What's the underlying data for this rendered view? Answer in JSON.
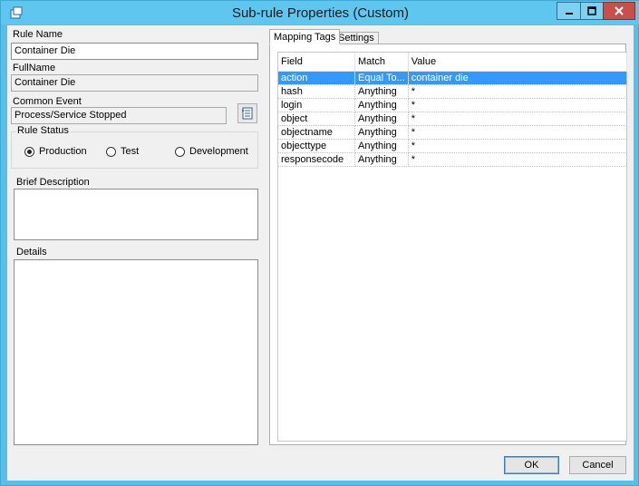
{
  "window": {
    "title": "Sub-rule Properties (Custom)"
  },
  "left": {
    "rule_name_label": "Rule Name",
    "rule_name_value": "Container Die",
    "fullname_label": "FullName",
    "fullname_value": "Container Die",
    "common_event_label": "Common Event",
    "common_event_value": "Process/Service Stopped",
    "rule_status_label": "Rule Status",
    "status_options": [
      {
        "label": "Production",
        "checked": true
      },
      {
        "label": "Test",
        "checked": false
      },
      {
        "label": "Development",
        "checked": false
      }
    ],
    "brief_description_label": "Brief Description",
    "details_label": "Details"
  },
  "tabs": [
    {
      "label": "Mapping Tags",
      "active": true
    },
    {
      "label": "Settings",
      "active": false
    }
  ],
  "grid": {
    "columns": [
      "Field",
      "Match",
      "Value"
    ],
    "rows": [
      {
        "field": "action",
        "match": "Equal To...",
        "value": "container die",
        "selected": true
      },
      {
        "field": "hash",
        "match": "Anything",
        "value": "*"
      },
      {
        "field": "login",
        "match": "Anything",
        "value": "*"
      },
      {
        "field": "object",
        "match": "Anything",
        "value": "*"
      },
      {
        "field": "objectname",
        "match": "Anything",
        "value": "*"
      },
      {
        "field": "objecttype",
        "match": "Anything",
        "value": "*"
      },
      {
        "field": "responsecode",
        "match": "Anything",
        "value": "*"
      }
    ]
  },
  "buttons": {
    "ok": "OK",
    "cancel": "Cancel"
  },
  "colors": {
    "titlebar": "#5ec6ef",
    "selection": "#3399ff",
    "close": "#c7504a"
  }
}
